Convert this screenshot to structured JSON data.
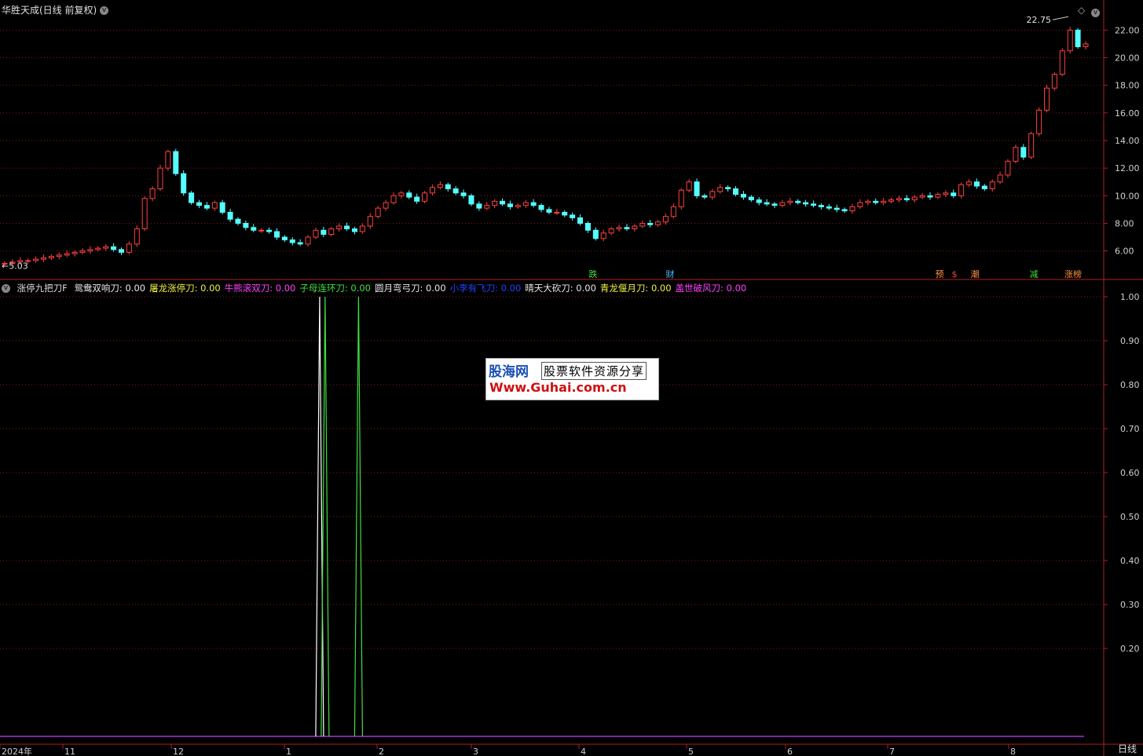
{
  "window": {
    "title": "华胜天成(日线 前复权)",
    "period_button": "日线"
  },
  "main_chart": {
    "high_label": "22.75",
    "low_label": "5.03",
    "yticks": [
      "22.00",
      "20.00",
      "18.00",
      "16.00",
      "14.00",
      "12.00",
      "10.00",
      "8.00",
      "6.00"
    ],
    "signals": [
      {
        "label": "跌",
        "color": "#40e040"
      },
      {
        "label": "财",
        "color": "#40c0ff"
      },
      {
        "label": "预",
        "color": "#ff9040"
      },
      {
        "label": "$",
        "color": "#ff4040"
      },
      {
        "label": "潮",
        "color": "#ff9040"
      },
      {
        "label": "减",
        "color": "#40e040"
      },
      {
        "label": "涨榜",
        "color": "#ff9040"
      }
    ]
  },
  "indicator": {
    "name": "涨停九把刀F",
    "lines": [
      {
        "label": "鸳鸯双响刀: 0.00",
        "color": "#e8e8e8"
      },
      {
        "label": "屠龙涨停刀: 0.00",
        "color": "#f0f040"
      },
      {
        "label": "牛熊滚双刀: 0.00",
        "color": "#ff40ff"
      },
      {
        "label": "子母连环刀: 0.00",
        "color": "#40e040"
      },
      {
        "label": "圆月弯弓刀: 0.00",
        "color": "#e8e8e8"
      },
      {
        "label": "小李有飞刀: 0.00",
        "color": "#2040ff"
      },
      {
        "label": "晴天大砍刀: 0.00",
        "color": "#e8e8e8"
      },
      {
        "label": "青龙偃月刀: 0.00",
        "color": "#f0f040"
      },
      {
        "label": "盖世破风刀: 0.00",
        "color": "#ff40ff"
      }
    ],
    "yticks": [
      "1.00",
      "0.90",
      "0.80",
      "0.70",
      "0.60",
      "0.50",
      "0.40",
      "0.30",
      "0.20"
    ]
  },
  "xaxis": [
    "2024年",
    "11",
    "12",
    "1",
    "2",
    "3",
    "4",
    "5",
    "6",
    "7",
    "8"
  ],
  "watermark": {
    "line1a": "股海网",
    "line1b": "股票软件资源分享",
    "line2": "Www.Guhai.com.cn"
  },
  "chart_data": [
    {
      "type": "candlestick",
      "title": "华胜天成(日线 前复权)",
      "ylim": [
        4.5,
        23.5
      ],
      "x_ticks": [
        "2024年",
        "11",
        "12",
        "1",
        "2",
        "3",
        "4",
        "5",
        "6",
        "7",
        "8"
      ],
      "close": [
        5.1,
        5.2,
        5.3,
        5.3,
        5.4,
        5.5,
        5.6,
        5.7,
        5.8,
        5.9,
        6.0,
        6.1,
        6.2,
        6.3,
        6.1,
        5.9,
        6.5,
        7.6,
        9.8,
        10.5,
        12.0,
        13.2,
        11.6,
        10.2,
        9.5,
        9.3,
        9.1,
        9.5,
        8.8,
        8.3,
        8.0,
        7.7,
        7.5,
        7.5,
        7.4,
        7.0,
        6.8,
        6.6,
        6.5,
        7.0,
        7.5,
        7.2,
        7.6,
        7.8,
        7.6,
        7.4,
        7.8,
        8.5,
        9.1,
        9.5,
        10.0,
        10.2,
        9.9,
        9.6,
        10.2,
        10.6,
        10.8,
        10.5,
        10.2,
        10.0,
        9.4,
        9.1,
        9.3,
        9.6,
        9.4,
        9.2,
        9.3,
        9.5,
        9.3,
        9.0,
        8.8,
        8.8,
        8.6,
        8.4,
        8.0,
        7.5,
        6.9,
        7.3,
        7.6,
        7.7,
        7.6,
        7.8,
        8.0,
        7.9,
        8.1,
        8.5,
        9.2,
        10.4,
        11.0,
        10.0,
        9.9,
        10.3,
        10.6,
        10.5,
        10.1,
        9.9,
        9.7,
        9.5,
        9.4,
        9.3,
        9.5,
        9.6,
        9.5,
        9.4,
        9.3,
        9.2,
        9.1,
        9.0,
        8.9,
        9.2,
        9.5,
        9.6,
        9.5,
        9.6,
        9.7,
        9.8,
        9.7,
        9.9,
        10.0,
        9.9,
        10.1,
        10.2,
        10.0,
        10.8,
        11.0,
        10.7,
        10.5,
        11.0,
        11.5,
        12.5,
        13.5,
        12.8,
        14.5,
        16.2,
        17.8,
        18.8,
        20.5,
        22.0,
        20.8,
        21.0
      ]
    },
    {
      "type": "line",
      "title": "涨停九把刀F",
      "ylim": [
        0,
        1
      ],
      "series": [
        {
          "name": "鸳鸯双响刀",
          "color": "#ffffff",
          "x": [
            40.5
          ],
          "y": [
            1
          ]
        },
        {
          "name": "子母连环刀",
          "color": "#40e040",
          "x": [
            41.2,
            45.5
          ],
          "y": [
            1,
            1
          ]
        }
      ]
    }
  ]
}
